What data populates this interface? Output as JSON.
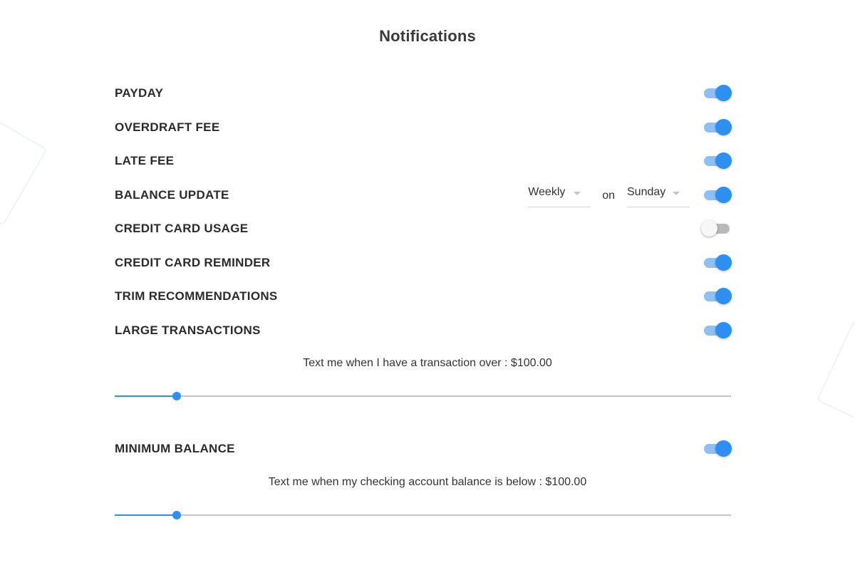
{
  "page": {
    "title": "Notifications"
  },
  "settings": [
    {
      "label": "PAYDAY",
      "enabled": true
    },
    {
      "label": "OVERDRAFT FEE",
      "enabled": true
    },
    {
      "label": "LATE FEE",
      "enabled": true
    },
    {
      "label": "BALANCE UPDATE",
      "enabled": true
    },
    {
      "label": "CREDIT CARD USAGE",
      "enabled": false
    },
    {
      "label": "CREDIT CARD REMINDER",
      "enabled": true
    },
    {
      "label": "TRIM RECOMMENDATIONS",
      "enabled": true
    },
    {
      "label": "LARGE TRANSACTIONS",
      "enabled": true
    },
    {
      "label": "MINIMUM BALANCE",
      "enabled": true
    }
  ],
  "balance_update": {
    "frequency": "Weekly",
    "on_label": "on",
    "day": "Sunday"
  },
  "large_transactions": {
    "caption": "Text me when I have a transaction over : $100.00",
    "slider_fraction": 0.1
  },
  "minimum_balance": {
    "caption": "Text me when my checking account balance is below : $100.00",
    "slider_fraction": 0.1
  },
  "colors": {
    "accent": "#2e8ff2",
    "accent_light": "#8fc0f4",
    "toggle_off_track": "#b9b9b9",
    "rail": "#c4c4c4"
  },
  "icons": {
    "dropdown": "chevron-down-icon"
  }
}
